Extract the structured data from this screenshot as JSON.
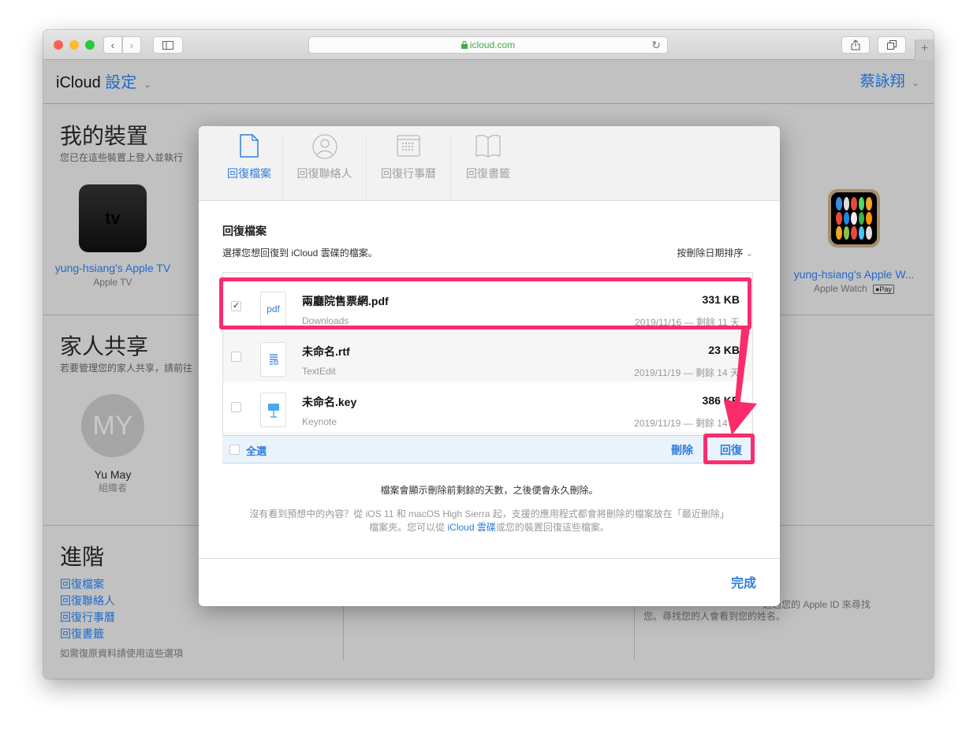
{
  "browser": {
    "url": "icloud.com",
    "icons": {
      "back": "chevron-left-icon",
      "forward": "chevron-right-icon",
      "sidebar": "sidebar-icon",
      "lock": "lock-icon",
      "reload": "reload-icon",
      "share": "share-icon",
      "tabs": "tabs-icon",
      "new_tab": "plus-icon"
    }
  },
  "header": {
    "app_name": "iCloud",
    "section_name": "設定",
    "user_name": "蔡詠翔"
  },
  "devices_section": {
    "title": "我的裝置",
    "subtitle": "您已在這些裝置上登入並執行",
    "devices": [
      {
        "name": "yung-hsiang's Apple TV",
        "type": "Apple TV",
        "badge": ""
      },
      {
        "name": "yung-hsiang's Apple W...",
        "type": "Apple Watch",
        "badge": "Pay"
      }
    ]
  },
  "family_section": {
    "title": "家人共享",
    "subtitle": "若要管理您的家人共享，請前往",
    "member": {
      "initials": "MY",
      "name": "Yu May",
      "role": "組織者"
    }
  },
  "advanced_section": {
    "title": "進階",
    "links": [
      "回復檔案",
      "回復聯絡人",
      "回復行事曆",
      "回復書籤"
    ],
    "note": "如需復原資料請使用這些選項",
    "right_text_line1": "透過您的 Apple ID 來尋找",
    "right_text_line2": "您。尋找您的人會看到您的姓名。"
  },
  "modal": {
    "tabs": [
      {
        "label": "回復檔案",
        "icon": "document-icon",
        "active": true
      },
      {
        "label": "回復聯絡人",
        "icon": "contact-icon",
        "active": false
      },
      {
        "label": "回復行事曆",
        "icon": "calendar-icon",
        "active": false
      },
      {
        "label": "回復書籤",
        "icon": "bookmark-book-icon",
        "active": false
      }
    ],
    "title": "回復檔案",
    "subtitle": "選擇您想回復到 iCloud 雲碟的檔案。",
    "sort_label": "按刪除日期排序",
    "files": [
      {
        "name": "兩廳院售票網.pdf",
        "source": "Downloads",
        "size": "331 KB",
        "date": "2019/11/16 — 剩餘 11 天",
        "checked": true,
        "icon_label": "pdf",
        "icon": "pdf-file-icon"
      },
      {
        "name": "未命名.rtf",
        "source": "TextEdit",
        "size": "23 KB",
        "date": "2019/11/19 — 剩餘 14 天",
        "checked": false,
        "icon_label": "",
        "icon": "text-file-icon"
      },
      {
        "name": "未命名.key",
        "source": "Keynote",
        "size": "386 KB",
        "date": "2019/11/19 — 剩餘 14 天",
        "checked": false,
        "icon_label": "",
        "icon": "keynote-file-icon"
      }
    ],
    "select_all_label": "全選",
    "delete_label": "刪除",
    "recover_label": "回復",
    "note_primary": "檔案會顯示刪除前剩餘的天數，之後便會永久刪除。",
    "note_secondary_part1": "沒有看到預想中的內容？從 iOS 11 和 macOS High Sierra 起，支援的應用程式都會將刪除的檔案放在「最近刪除」檔案夾。您可以從 ",
    "note_secondary_link": "iCloud 雲碟",
    "note_secondary_part2": "或您的裝置回復這些檔案。",
    "done_label": "完成"
  },
  "annotation": {
    "highlight_color": "#fb2c6c"
  },
  "colors": {
    "accent": "#2f7ddb",
    "link_dim": "#1f6acb",
    "url_green": "#3fae49"
  }
}
